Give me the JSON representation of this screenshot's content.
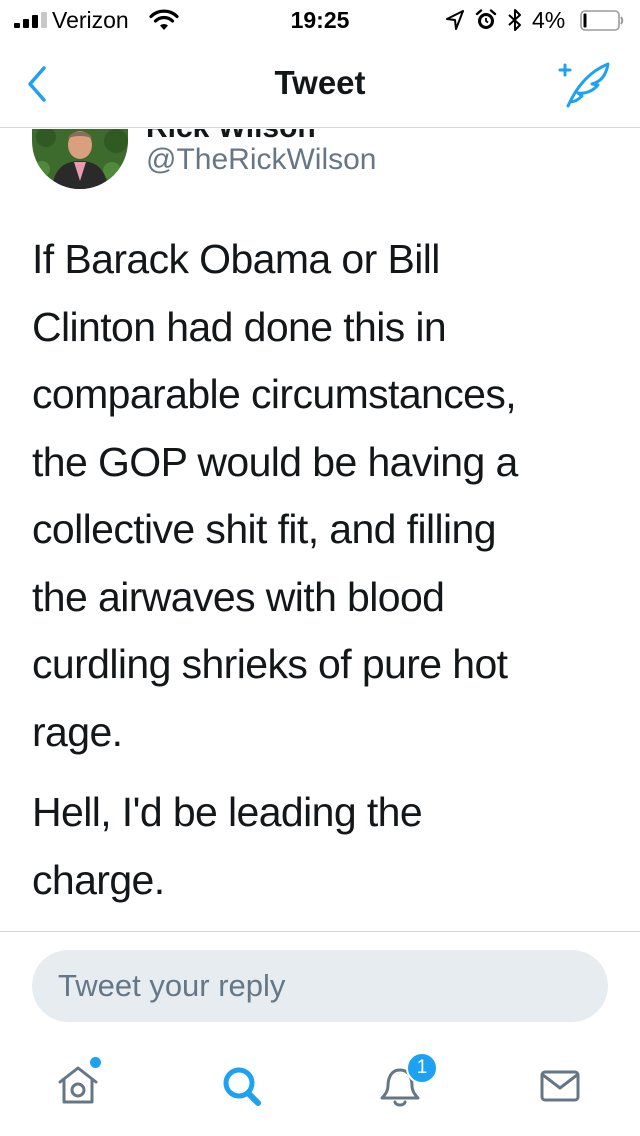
{
  "status_bar": {
    "carrier": "Verizon",
    "time": "19:25",
    "battery_percent": "4%",
    "icons": [
      "signal-icon",
      "wifi-icon",
      "location-icon",
      "alarm-icon",
      "bluetooth-icon",
      "battery-icon"
    ]
  },
  "nav": {
    "title": "Tweet",
    "back_icon": "chevron-left-icon",
    "compose_icon": "compose-tweet-icon"
  },
  "tweet": {
    "author_name": "Rick Wilson",
    "handle": "@TheRickWilson",
    "paragraphs": [
      "If Barack Obama or Bill\nClinton had done this in\ncomparable   circumstances,\nthe GOP would be having a\ncollective shit fit, and filling\nthe airwaves with blood\ncurdling shrieks of pure hot\nrage.",
      "Hell, I'd be leading the\ncharge."
    ]
  },
  "reply": {
    "placeholder": "Tweet your reply"
  },
  "tab_bar": {
    "tabs": [
      {
        "name": "home",
        "icon": "home-icon",
        "indicator": true
      },
      {
        "name": "search",
        "icon": "search-icon",
        "active": true
      },
      {
        "name": "notifications",
        "icon": "bell-icon",
        "badge": "1"
      },
      {
        "name": "messages",
        "icon": "envelope-icon"
      }
    ]
  },
  "colors": {
    "accent": "#1da1f2",
    "text": "#14171a",
    "secondary_text": "#657786",
    "reply_bg": "#e6ecf0"
  }
}
